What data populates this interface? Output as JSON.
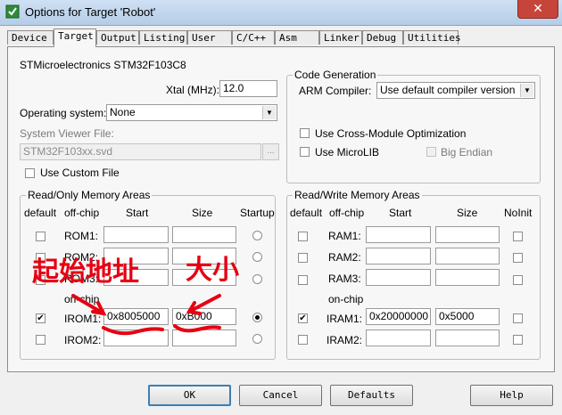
{
  "window": {
    "title": "Options for Target 'Robot'",
    "close_glyph": "✕"
  },
  "tabs": [
    "Device",
    "Target",
    "Output",
    "Listing",
    "User",
    "C/C++",
    "Asm",
    "Linker",
    "Debug",
    "Utilities"
  ],
  "device_name": "STMicroelectronics STM32F103C8",
  "xtal": {
    "label": "Xtal (MHz):",
    "value": "12.0"
  },
  "operating_system": {
    "label": "Operating system:",
    "value": "None"
  },
  "system_viewer": {
    "label": "System Viewer File:",
    "value": "STM32F103xx.svd",
    "browse": "..."
  },
  "use_custom_file": "Use Custom File",
  "code_generation": {
    "title": "Code Generation",
    "arm_compiler_label": "ARM Compiler:",
    "arm_compiler_value": "Use default compiler version",
    "cross_module": "Use Cross-Module Optimization",
    "microlib": "Use MicroLIB",
    "big_endian": "Big Endian"
  },
  "ro_memory": {
    "title": "Read/Only Memory Areas",
    "headers": {
      "default": "default",
      "offchip": "off-chip",
      "start": "Start",
      "size": "Size",
      "startup": "Startup"
    },
    "onchip_label": "on-chip",
    "rows": [
      {
        "label": "ROM1:",
        "start": "",
        "size": "",
        "default": false,
        "startup": false
      },
      {
        "label": "ROM2:",
        "start": "",
        "size": "",
        "default": false,
        "startup": false
      },
      {
        "label": "ROM3:",
        "start": "",
        "size": "",
        "default": false,
        "startup": false
      },
      {
        "label": "IROM1:",
        "start": "0x8005000",
        "size": "0xB000",
        "default": true,
        "startup": true
      },
      {
        "label": "IROM2:",
        "start": "",
        "size": "",
        "default": false,
        "startup": false
      }
    ]
  },
  "rw_memory": {
    "title": "Read/Write Memory Areas",
    "headers": {
      "default": "default",
      "offchip": "off-chip",
      "start": "Start",
      "size": "Size",
      "noinit": "NoInit"
    },
    "onchip_label": "on-chip",
    "rows": [
      {
        "label": "RAM1:",
        "start": "",
        "size": "",
        "default": false,
        "noinit": false
      },
      {
        "label": "RAM2:",
        "start": "",
        "size": "",
        "default": false,
        "noinit": false
      },
      {
        "label": "RAM3:",
        "start": "",
        "size": "",
        "default": false,
        "noinit": false
      },
      {
        "label": "IRAM1:",
        "start": "0x20000000",
        "size": "0x5000",
        "default": true,
        "noinit": false
      },
      {
        "label": "IRAM2:",
        "start": "",
        "size": "",
        "default": false,
        "noinit": false
      }
    ]
  },
  "buttons": {
    "ok": "OK",
    "cancel": "Cancel",
    "defaults": "Defaults",
    "help": "Help"
  },
  "annotations": {
    "start_address": "起始地址",
    "size": "大小"
  },
  "colors": {
    "annotation_red": "#e60012",
    "titlebar": "#c3d7ee"
  }
}
